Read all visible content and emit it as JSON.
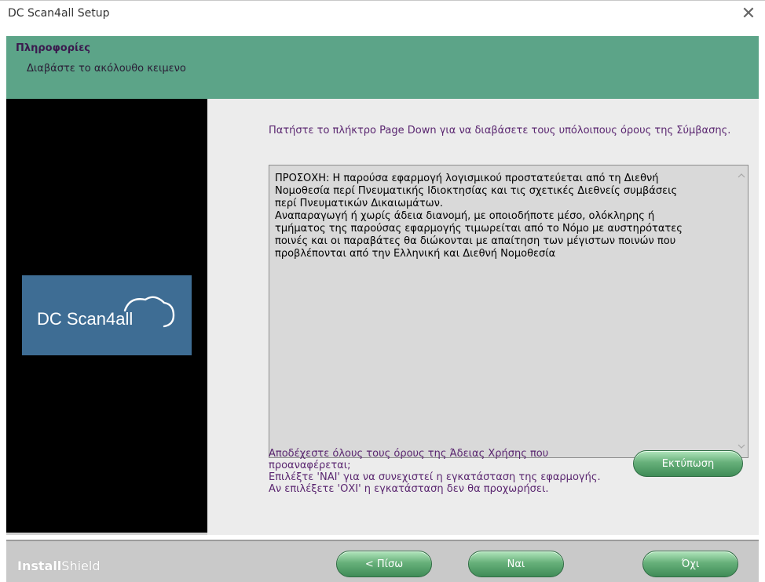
{
  "window": {
    "title": "DC Scan4all Setup",
    "close_glyph": "✕"
  },
  "header": {
    "title": "Πληροφορίες",
    "subtitle": "Διαβάστε το ακόλουθο κειμενο"
  },
  "logo": {
    "text": "DC Scan4all",
    "bg_color": "#3e6d94"
  },
  "instructions": "Πατήστε το πλήκτρο Page Down για να διαβάσετε τους υπόλοιπους όρους της Σύμβασης.",
  "license": {
    "lines": [
      "ΠΡΟΣΟΧΗ: Η παρούσα εφαρμογή λογισμικού προστατεύεται από τη Διεθνή",
      "Νομοθεσία περί Πνευματικής Ιδιοκτησίας και τις σχετικές Διεθνείς συμβάσεις",
      "περί Πνευματικών Δικαιωμάτων.",
      "Αναπαραγωγή ή χωρίς άδεια διανομή, με οποιοδήποτε  μέσο, ολόκληρης ή",
      "τμήματος της παρούσας εφαρμογής τιμωρείται από το Νόμο με αυστηρότατες",
      "ποινές και οι παραβάτες θα διώκονται με απαίτηση των μέγιστων ποινών που",
      "προβλέπονται από την Ελληνική και Διεθνή Νομοθεσία"
    ]
  },
  "accept": {
    "lines": [
      "Αποδέχεστε όλους τους όρους της Άδειας Χρήσης που",
      "προαναφέρεται;",
      "Επιλέξτε 'ΝΑΙ' για να συνεχιστεί η εγκατάσταση της εφαρμογής.",
      "Αν επιλέξετε 'ΟΧΙ' η εγκατάσταση δεν θα προχωρήσει."
    ]
  },
  "buttons": {
    "print": "Εκτύπωση",
    "back": "< Πίσω",
    "yes": "Ναι",
    "no": "Όχι"
  },
  "brand": {
    "part1": "Install",
    "part2": "Shield"
  },
  "colors": {
    "header_bg": "#5ca488",
    "text_purple": "#5a2670",
    "button_green": "#67b07a"
  },
  "icons": {
    "close": "close-icon",
    "scroll_up": "chevron-up-icon",
    "scroll_down": "chevron-down-icon"
  }
}
